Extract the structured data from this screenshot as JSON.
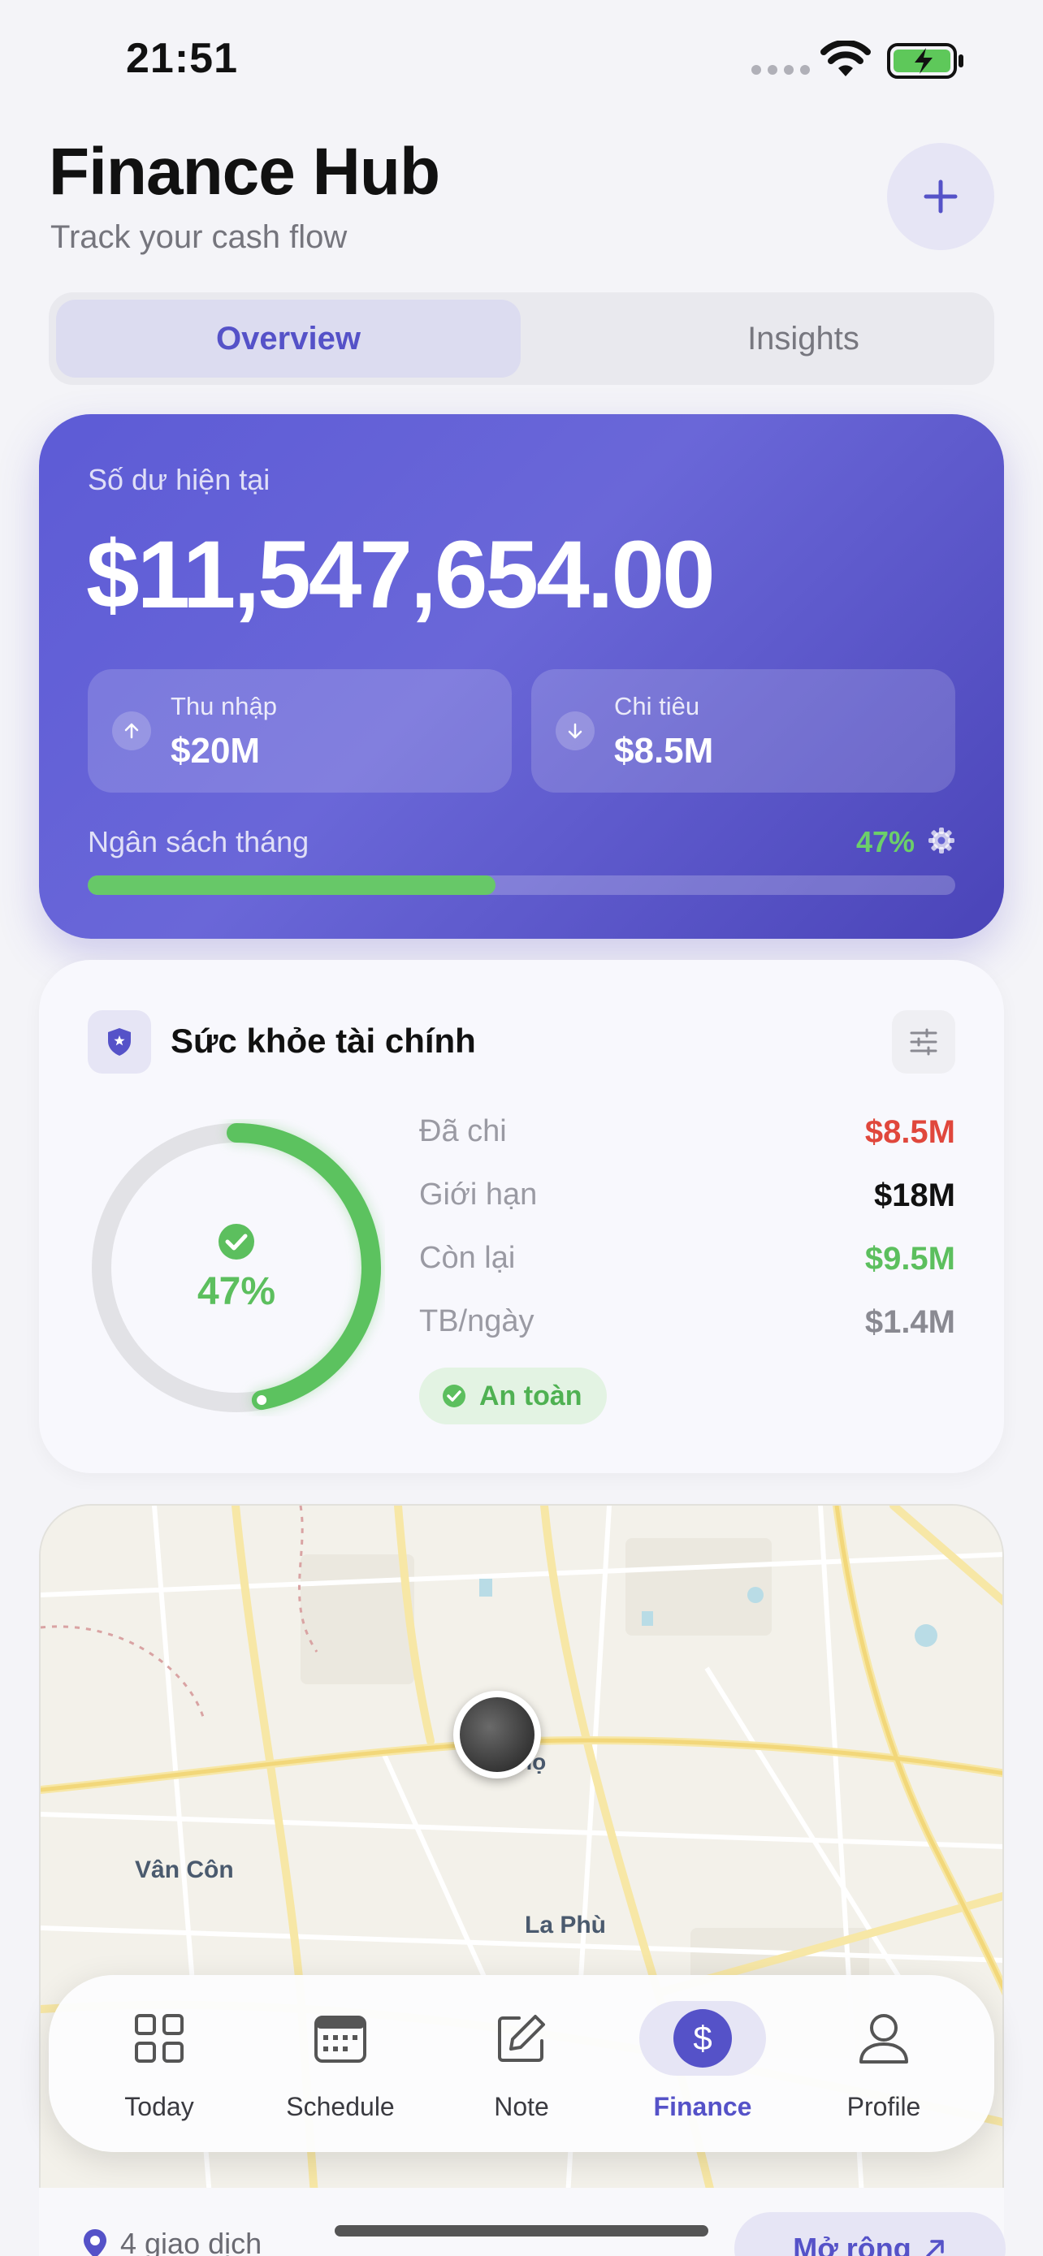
{
  "status_bar": {
    "time": "21:51"
  },
  "header": {
    "title": "Finance Hub",
    "subtitle": "Track your cash flow",
    "add_icon": "plus-icon"
  },
  "segments": [
    {
      "label": "Overview",
      "active": true
    },
    {
      "label": "Insights",
      "active": false
    }
  ],
  "balance": {
    "label": "Số dư hiện tại",
    "value": "$11,547,654.00",
    "income": {
      "label": "Thu nhập",
      "value": "$20M",
      "icon": "arrow-up-icon"
    },
    "expense": {
      "label": "Chi tiêu",
      "value": "$8.5M",
      "icon": "arrow-down-icon"
    },
    "budget_label": "Ngân sách tháng",
    "budget_percent": "47%",
    "budget_fraction": 0.47
  },
  "health": {
    "title": "Sức khỏe tài chính",
    "ring_percent": "47%",
    "ring_fraction": 0.47,
    "metrics": [
      {
        "label": "Đã chi",
        "value": "$8.5M",
        "color": "#e0473c"
      },
      {
        "label": "Giới hạn",
        "value": "$18M",
        "color": "#111111"
      },
      {
        "label": "Còn lại",
        "value": "$9.5M",
        "color": "#5cbf5e"
      },
      {
        "label": "TB/ngày",
        "value": "$1.4M",
        "color": "#8a8a92"
      }
    ],
    "status": "An toàn"
  },
  "map": {
    "labels": {
      "van_con": "Vân Côn",
      "la_phu": "La Phù",
      "partial": "họ"
    },
    "transactions": "4 giao dịch",
    "expand_label": "Mở rộng"
  },
  "tabs": [
    {
      "label": "Today",
      "icon": "grid-icon",
      "active": false
    },
    {
      "label": "Schedule",
      "icon": "calendar-icon",
      "active": false
    },
    {
      "label": "Note",
      "icon": "edit-icon",
      "active": false
    },
    {
      "label": "Finance",
      "icon": "dollar-icon",
      "active": true
    },
    {
      "label": "Profile",
      "icon": "person-icon",
      "active": false
    }
  ],
  "colors": {
    "accent": "#5552c8",
    "success": "#5cbf5e",
    "danger": "#e0473c"
  }
}
